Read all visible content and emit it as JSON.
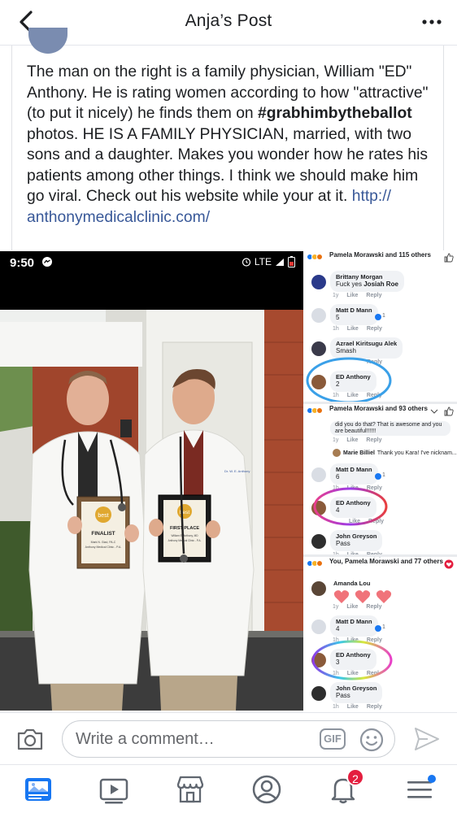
{
  "header": {
    "title": "Anja’s Post",
    "back_icon": "chevron-left-icon",
    "more_icon": "more-horizontal-icon"
  },
  "post": {
    "text_part1": "The man on the right is a family physician, William \"ED\" Anthony. He is rating women according to how \"attractive\" (to put it nicely) he finds them on ",
    "hashtag": "#grabhimbytheballot",
    "text_part2": " photos. HE IS A FAMILY PHYSICIAN, married, with two sons and a daughter. Makes you wonder how he rates his patients among other things. I think we should make him go viral. Check out his website while your at it. ",
    "link": "http://\nanthonymedicalclinic.com/"
  },
  "screenshot": {
    "status_time": "9:50",
    "status_network": "LTE",
    "plaque_left": {
      "badge": "best",
      "title": "FINALIST",
      "line1": "Mark N. Glad, PA-C",
      "line2": "Anthony Medical Clinic - P.A."
    },
    "plaque_right": {
      "badge": "best",
      "title": "FIRST PLACE",
      "line1": "William E. Anthony, MD",
      "line2": "Anthony Medical Clinic - P.A."
    },
    "coat_left": "",
    "coat_right": "Dr. W. E. Anthony"
  },
  "threads": [
    {
      "header": "Pamela Morawski and 115 others",
      "comments": [
        {
          "name": "Brittany Morgan",
          "text": "Fuck yes ",
          "mention": "Josiah Roe",
          "time": "1y",
          "like": "Like",
          "reply": "Reply"
        },
        {
          "name": "Matt D Mann",
          "text": "5",
          "time": "1h",
          "like": "Like",
          "reply": "Reply",
          "reactions": "1"
        },
        {
          "name": "Azrael Kiritsugu Alek",
          "text": "Smash",
          "time": "",
          "like": "",
          "reply": "Reply"
        },
        {
          "name": "ED Anthony",
          "text": "2",
          "time": "1h",
          "like": "Like",
          "reply": "Reply"
        }
      ]
    },
    {
      "header": "Pamela Morawski and 93 others",
      "overflow_text": "did you do that? That is awesome and you are beautiful!!!!!!",
      "overflow_meta": {
        "time": "1y",
        "like": "Like",
        "reply": "Reply"
      },
      "reply_preview": {
        "name": "Marie Billiel",
        "text": "Thank you Kara! I've nicknam..."
      },
      "comments": [
        {
          "name": "Matt D Mann",
          "text": "6",
          "time": "1h",
          "like": "Like",
          "reply": "Reply",
          "reactions": "1"
        },
        {
          "name": "ED Anthony",
          "text": "4",
          "time": "",
          "like": "Like",
          "reply": "Reply"
        },
        {
          "name": "John Greyson",
          "text": "Pass",
          "time": "1h",
          "like": "Like",
          "reply": "Reply"
        }
      ]
    },
    {
      "header": "You, Pamela Morawski and 77 others",
      "comments": [
        {
          "name": "Amanda Lou",
          "text": "",
          "time": "1y",
          "like": "Like",
          "reply": "Reply"
        },
        {
          "name": "Matt D Mann",
          "text": "4",
          "time": "1h",
          "like": "Like",
          "reply": "Reply",
          "reactions": "1"
        },
        {
          "name": "ED Anthony",
          "text": "3",
          "time": "1h",
          "like": "Like",
          "reply": "Repl"
        },
        {
          "name": "John Greyson",
          "text": "Pass",
          "time": "1h",
          "like": "Like",
          "reply": "Reply"
        }
      ]
    }
  ],
  "composer": {
    "placeholder": "Write a comment…",
    "gif_label": "GIF"
  },
  "tabbar": {
    "notifications_badge": "2",
    "icons": [
      "news-feed-icon",
      "watch-icon",
      "marketplace-icon",
      "profile-icon",
      "bell-icon",
      "menu-icon"
    ]
  },
  "colors": {
    "brand_blue": "#1877f2",
    "link_blue": "#385898",
    "badge_red": "#e41e3f",
    "circle_blue": "#3aa0e8"
  }
}
